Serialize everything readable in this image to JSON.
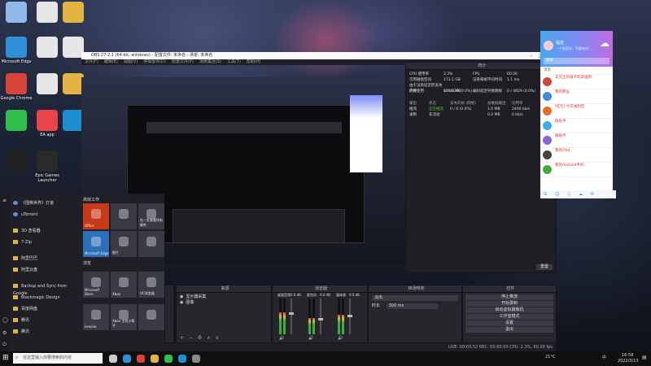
{
  "desktop": {
    "icons": [
      {
        "label": "",
        "icon": "recycle-bin-icon",
        "color": "#8fb8e8"
      },
      {
        "label": "",
        "icon": "document-icon",
        "color": "#e6e6e6"
      },
      {
        "label": "",
        "icon": "folder-icon",
        "color": "#e2b442"
      },
      {
        "label": "Microsoft Edge",
        "icon": "edge-icon",
        "color": "#2f8fd8"
      },
      {
        "label": "",
        "icon": "document-icon",
        "color": "#e6e6e6"
      },
      {
        "label": "",
        "icon": "document-icon",
        "color": "#e6e6e6"
      },
      {
        "label": "Google Chrome",
        "icon": "chrome-icon",
        "color": "#d8443a"
      },
      {
        "label": "",
        "icon": "document-icon",
        "color": "#e6e6e6"
      },
      {
        "label": "",
        "icon": "folder-icon",
        "color": "#e2b442"
      },
      {
        "label": "",
        "icon": "wechat-icon",
        "color": "#2fbf4a"
      },
      {
        "label": "EA app",
        "icon": "ea-icon",
        "color": "#e8444a"
      },
      {
        "label": "",
        "icon": "q-app-icon",
        "color": "#1b8fd0"
      },
      {
        "label": "",
        "icon": "qq-icon",
        "color": "#222222"
      },
      {
        "label": "Epic Games Launcher",
        "icon": "epic-games-icon",
        "color": "#2a2a2a"
      }
    ]
  },
  "obs": {
    "window_title": "OBS 27.2.1 (64-bit, windows) - 配置文件: 未命名 - 场景: 未命名",
    "menu": [
      "文件(F)",
      "编辑(E)",
      "视图(V)",
      "停靠部件(D)",
      "配置文件(P)",
      "场景集合(S)",
      "工具(T)",
      "帮助(H)"
    ],
    "stats_title": "统计",
    "stats_lines": [
      [
        "CPU 使用率",
        "2.3%",
        "FPS",
        "60.00"
      ],
      [
        "可用磁盘空间",
        "171.1 GB",
        "渲染每帧平均时间",
        "1.1 ms"
      ],
      [
        "由于渲染延迟而丢失的帧",
        "0 / 4829 (0.0%)",
        "编码延迟导致跳帧",
        "0 / 4829 (0.0%)"
      ],
      [
        "内存使用",
        "188.0 MB",
        "",
        ""
      ]
    ],
    "stats_table_headers": [
      "输出",
      "状态",
      "丢失的帧 (网络)",
      "总数据输出",
      "比特率"
    ],
    "stats_table_rows": [
      [
        "推流",
        "正在推流",
        "0 / 0 (0.0%)",
        "1.0 MB",
        "2400 kb/s"
      ],
      [
        "录制",
        "非活动",
        "",
        "0.0 MB",
        "0 kb/s"
      ]
    ],
    "reset_label": "重置",
    "scenes_title": "场景",
    "sources_title": "来源",
    "sources": [
      "显示器采集",
      "图像"
    ],
    "mixer_title": "混音器",
    "mixer_channels": [
      {
        "name": "桌面音频",
        "db": "0.0 dB",
        "level": 0.62
      },
      {
        "name": "麦克风",
        "db": "0.0 dB",
        "level": 0.45
      },
      {
        "name": "媒体源",
        "db": "0.0 dB",
        "level": 0.55
      }
    ],
    "transition_title": "转场特效",
    "transition_value": "淡出",
    "duration_label": "时长",
    "duration_value": "300 ms",
    "controls_title": "控件",
    "controls": [
      "停止推流",
      "开始录制",
      "启动虚拟摄像机",
      "工作室模式",
      "设置",
      "退出"
    ],
    "status_bar": "LIVE: 00:03:52   REC: 00:00:00   CPU: 2.3%, 60.00 fps"
  },
  "qq": {
    "user": "临岩",
    "signature": "一个老同学，不要有对...",
    "search_placeholder": "搜索",
    "tab": "消息",
    "chats": [
      {
        "name": "又见王的骑子的高福鸽",
        "msg": "",
        "color": "#d6453a"
      },
      {
        "name": "我的网址",
        "msg": "",
        "color": "#3a8fd8"
      },
      {
        "name": "[红包] 今年福利区",
        "msg": "",
        "color": "#e66b2a"
      },
      {
        "name": "群助手",
        "msg": "",
        "color": "#3ab0e8"
      },
      {
        "name": "群助手",
        "msg": "",
        "color": "#8a64d8"
      },
      {
        "name": "我的iPad",
        "msg": "",
        "color": "#444"
      },
      {
        "name": "我的Android手机",
        "msg": "",
        "color": "#44a844"
      }
    ]
  },
  "start_menu": {
    "left_items": [
      "",
      "",
      "",
      "",
      "",
      "",
      "",
      "",
      ""
    ],
    "groups": [
      "高效工作",
      "浏览"
    ],
    "list_items": [
      "《围棋世界》打谱",
      "uTorrent",
      "3D 查看器",
      "7-Zip",
      "阿里巴巴",
      "阿里云盘",
      "Backup and Sync from Google",
      "Blackmagic Design",
      "百度网盘",
      "腾讯",
      "腾讯"
    ],
    "tiles": [
      {
        "label": "Office",
        "color": "#c8381a",
        "icon": "office-icon"
      },
      {
        "label": "",
        "color": "#3a3a44",
        "icon": "apps-icon"
      },
      {
        "label": "在一处查看所有邮件",
        "color": "#3a3a44",
        "icon": "mail-icon"
      },
      {
        "label": "Microsoft Edge",
        "color": "#2d6fb8",
        "icon": "edge-icon"
      },
      {
        "label": "照片",
        "color": "#3a3a44",
        "icon": "photos-icon"
      },
      {
        "label": "",
        "color": "#3a3a44",
        "icon": "obs-icon"
      },
      {
        "label": "Microsoft Store",
        "color": "#3a3a44",
        "icon": "store-icon"
      },
      {
        "label": "Xbox",
        "color": "#3a3a44",
        "icon": "xbox-icon"
      },
      {
        "label": "UC浏览器",
        "color": "#3a3a44",
        "icon": "uc-browser-icon"
      },
      {
        "label": "Lenovo",
        "color": "#3a3a44",
        "icon": "lenovo-icon"
      },
      {
        "label": "Xbox 主机小帮手",
        "color": "#3a3a44",
        "icon": "xbox-companion-icon"
      },
      {
        "label": "",
        "color": "#3a3a44",
        "icon": "feather-icon"
      }
    ]
  },
  "taskbar": {
    "search_placeholder": "在这里输入你要搜索的内容",
    "weather": "21°C",
    "ime": "中",
    "time": "16:58",
    "date": "2022/3/13",
    "app_icons": [
      "task-view-icon",
      "edge-icon",
      "chrome-icon",
      "explorer-icon",
      "wechat-icon",
      "qq-icon",
      "obs-icon"
    ]
  }
}
